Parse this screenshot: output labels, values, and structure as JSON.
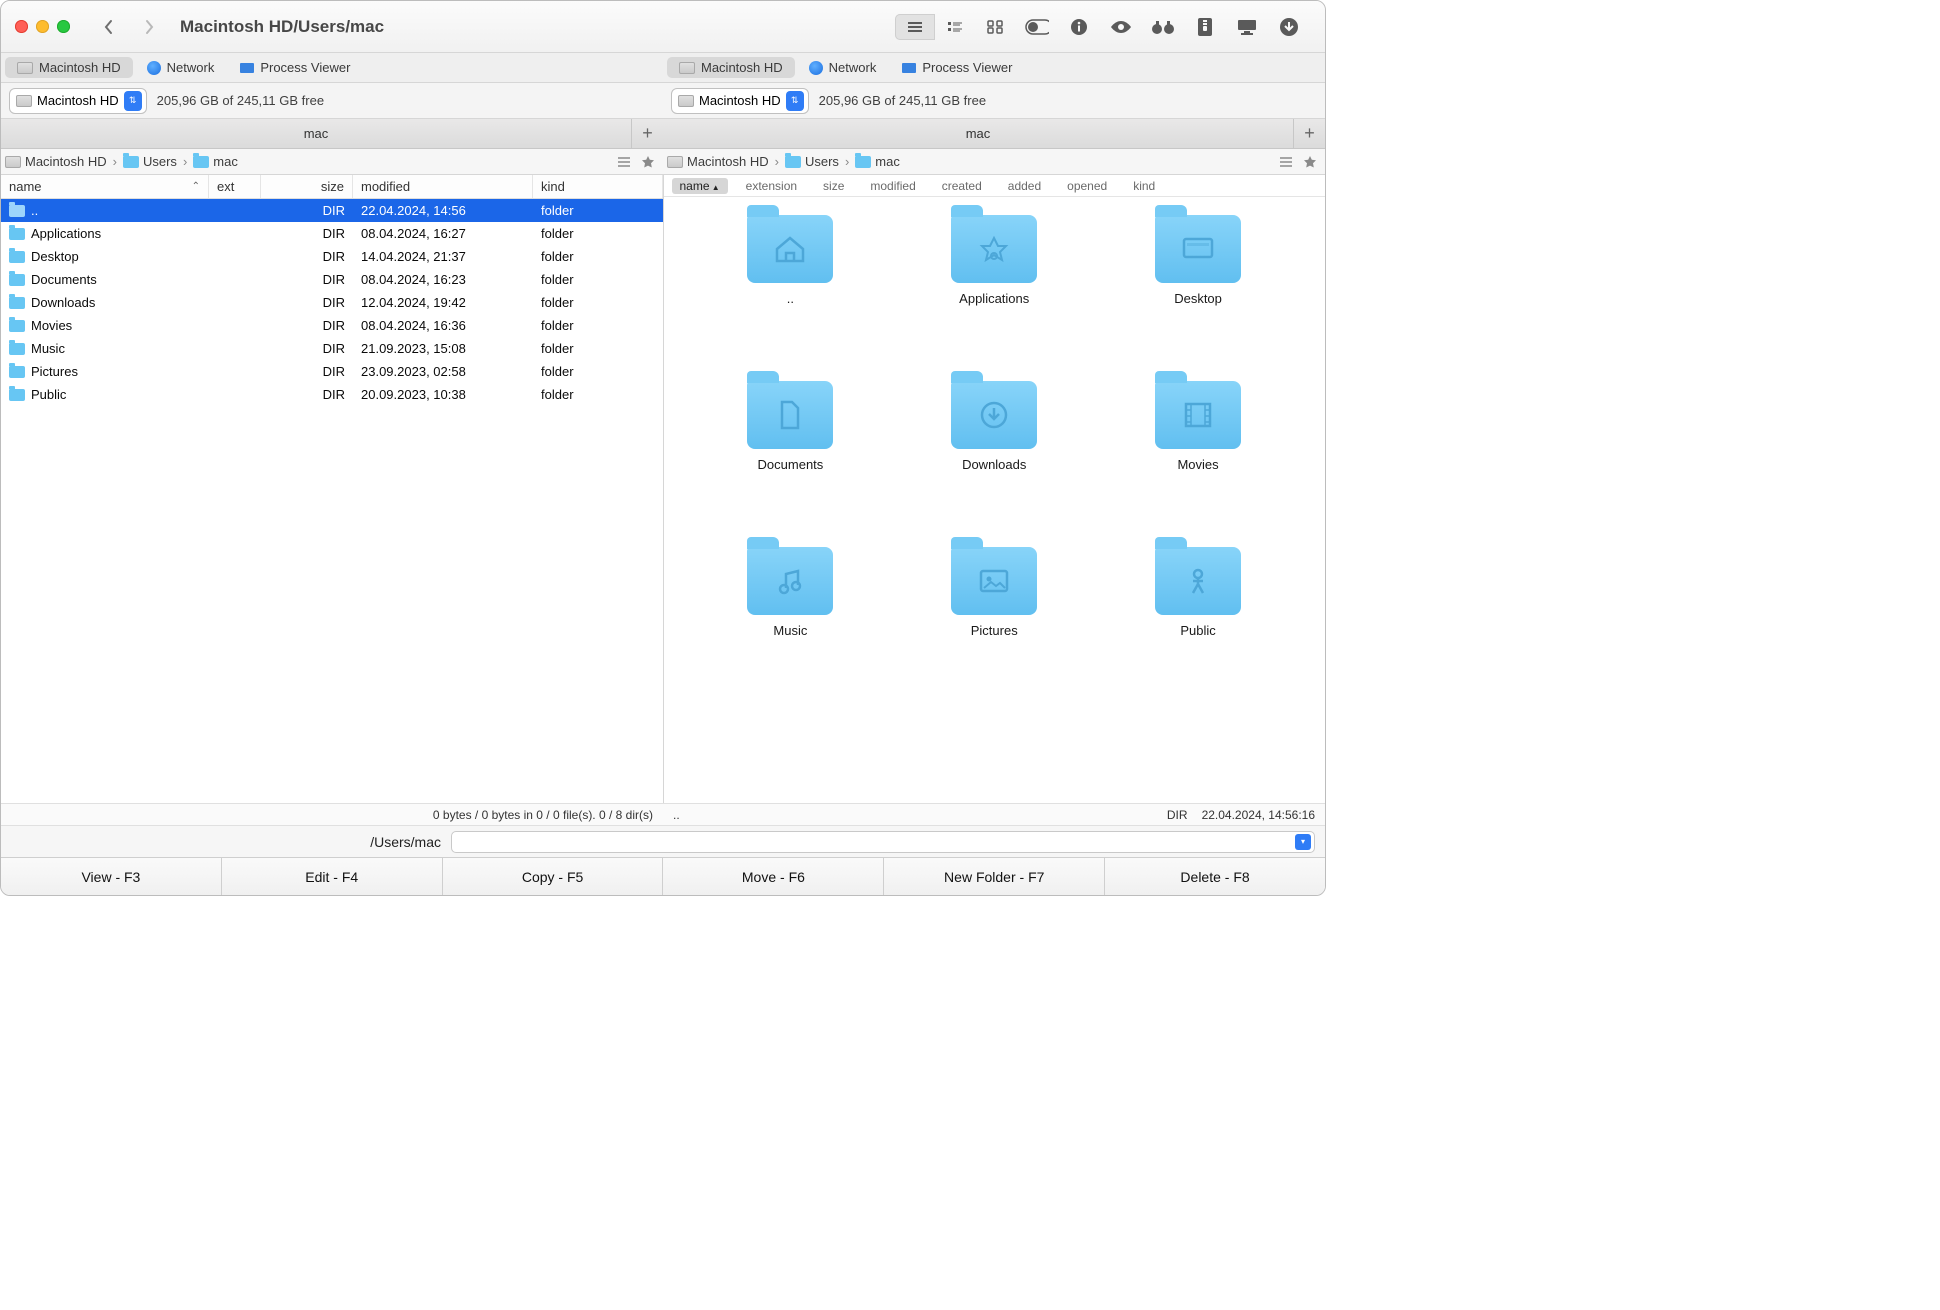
{
  "titlebar": {
    "path": "Macintosh HD/Users/mac"
  },
  "sec_tabs": {
    "left": [
      {
        "label": "Macintosh HD",
        "icon": "hd",
        "active": true
      },
      {
        "label": "Network",
        "icon": "globe",
        "active": false
      },
      {
        "label": "Process Viewer",
        "icon": "monitor",
        "active": false
      }
    ],
    "right": [
      {
        "label": "Macintosh HD",
        "icon": "hd",
        "active": true
      },
      {
        "label": "Network",
        "icon": "globe",
        "active": false
      },
      {
        "label": "Process Viewer",
        "icon": "monitor",
        "active": false
      }
    ]
  },
  "drive": {
    "left": {
      "name": "Macintosh HD",
      "free": "205,96 GB of 245,11 GB free"
    },
    "right": {
      "name": "Macintosh HD",
      "free": "205,96 GB of 245,11 GB free"
    }
  },
  "tabstrip": {
    "left_tab": "mac",
    "right_tab": "mac"
  },
  "breadcrumbs": {
    "left": [
      "Macintosh HD",
      "Users",
      "mac"
    ],
    "right": [
      "Macintosh HD",
      "Users",
      "mac"
    ]
  },
  "list_headers": {
    "name": "name",
    "ext": "ext",
    "size": "size",
    "modified": "modified",
    "kind": "kind"
  },
  "list_rows": [
    {
      "name": "..",
      "size": "DIR",
      "modified": "22.04.2024, 14:56",
      "kind": "folder",
      "selected": true
    },
    {
      "name": "Applications",
      "size": "DIR",
      "modified": "08.04.2024, 16:27",
      "kind": "folder"
    },
    {
      "name": "Desktop",
      "size": "DIR",
      "modified": "14.04.2024, 21:37",
      "kind": "folder"
    },
    {
      "name": "Documents",
      "size": "DIR",
      "modified": "08.04.2024, 16:23",
      "kind": "folder"
    },
    {
      "name": "Downloads",
      "size": "DIR",
      "modified": "12.04.2024, 19:42",
      "kind": "folder"
    },
    {
      "name": "Movies",
      "size": "DIR",
      "modified": "08.04.2024, 16:36",
      "kind": "folder"
    },
    {
      "name": "Music",
      "size": "DIR",
      "modified": "21.09.2023, 15:08",
      "kind": "folder"
    },
    {
      "name": "Pictures",
      "size": "DIR",
      "modified": "23.09.2023, 02:58",
      "kind": "folder"
    },
    {
      "name": "Public",
      "size": "DIR",
      "modified": "20.09.2023, 10:38",
      "kind": "folder"
    }
  ],
  "sort_bar": [
    "name",
    "extension",
    "size",
    "modified",
    "created",
    "added",
    "opened",
    "kind"
  ],
  "sort_active": "name",
  "grid_items": [
    {
      "label": "..",
      "icon": "home"
    },
    {
      "label": "Applications",
      "icon": "app"
    },
    {
      "label": "Desktop",
      "icon": "desktop"
    },
    {
      "label": "Documents",
      "icon": "doc"
    },
    {
      "label": "Downloads",
      "icon": "download"
    },
    {
      "label": "Movies",
      "icon": "movie"
    },
    {
      "label": "Music",
      "icon": "music"
    },
    {
      "label": "Pictures",
      "icon": "picture"
    },
    {
      "label": "Public",
      "icon": "public"
    }
  ],
  "status": {
    "left": "0 bytes / 0 bytes in 0 / 0 file(s). 0 / 8 dir(s)",
    "right_path": "..",
    "right_kind": "DIR",
    "right_date": "22.04.2024, 14:56:16"
  },
  "path_row": {
    "label": "/Users/mac"
  },
  "fn_buttons": [
    "View - F3",
    "Edit - F4",
    "Copy - F5",
    "Move - F6",
    "New Folder - F7",
    "Delete - F8"
  ]
}
